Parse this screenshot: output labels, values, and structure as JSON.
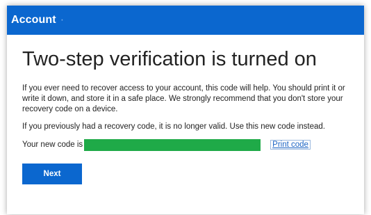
{
  "header": {
    "title": "Account",
    "accent_color": "#0b67cf"
  },
  "main": {
    "heading": "Two-step verification is turned on",
    "paragraph1": "If you ever need to recover access to your account, this code will help. You should print it or write it down, and store it in a safe place. We strongly recommend that you don't store your recovery code on a device.",
    "paragraph2": "If you previously had a recovery code, it is no longer valid. Use this new code instead.",
    "code_label": "Your new code is",
    "code_redaction_color": "#1faa48",
    "print_link": "Print code",
    "next_button": "Next"
  }
}
